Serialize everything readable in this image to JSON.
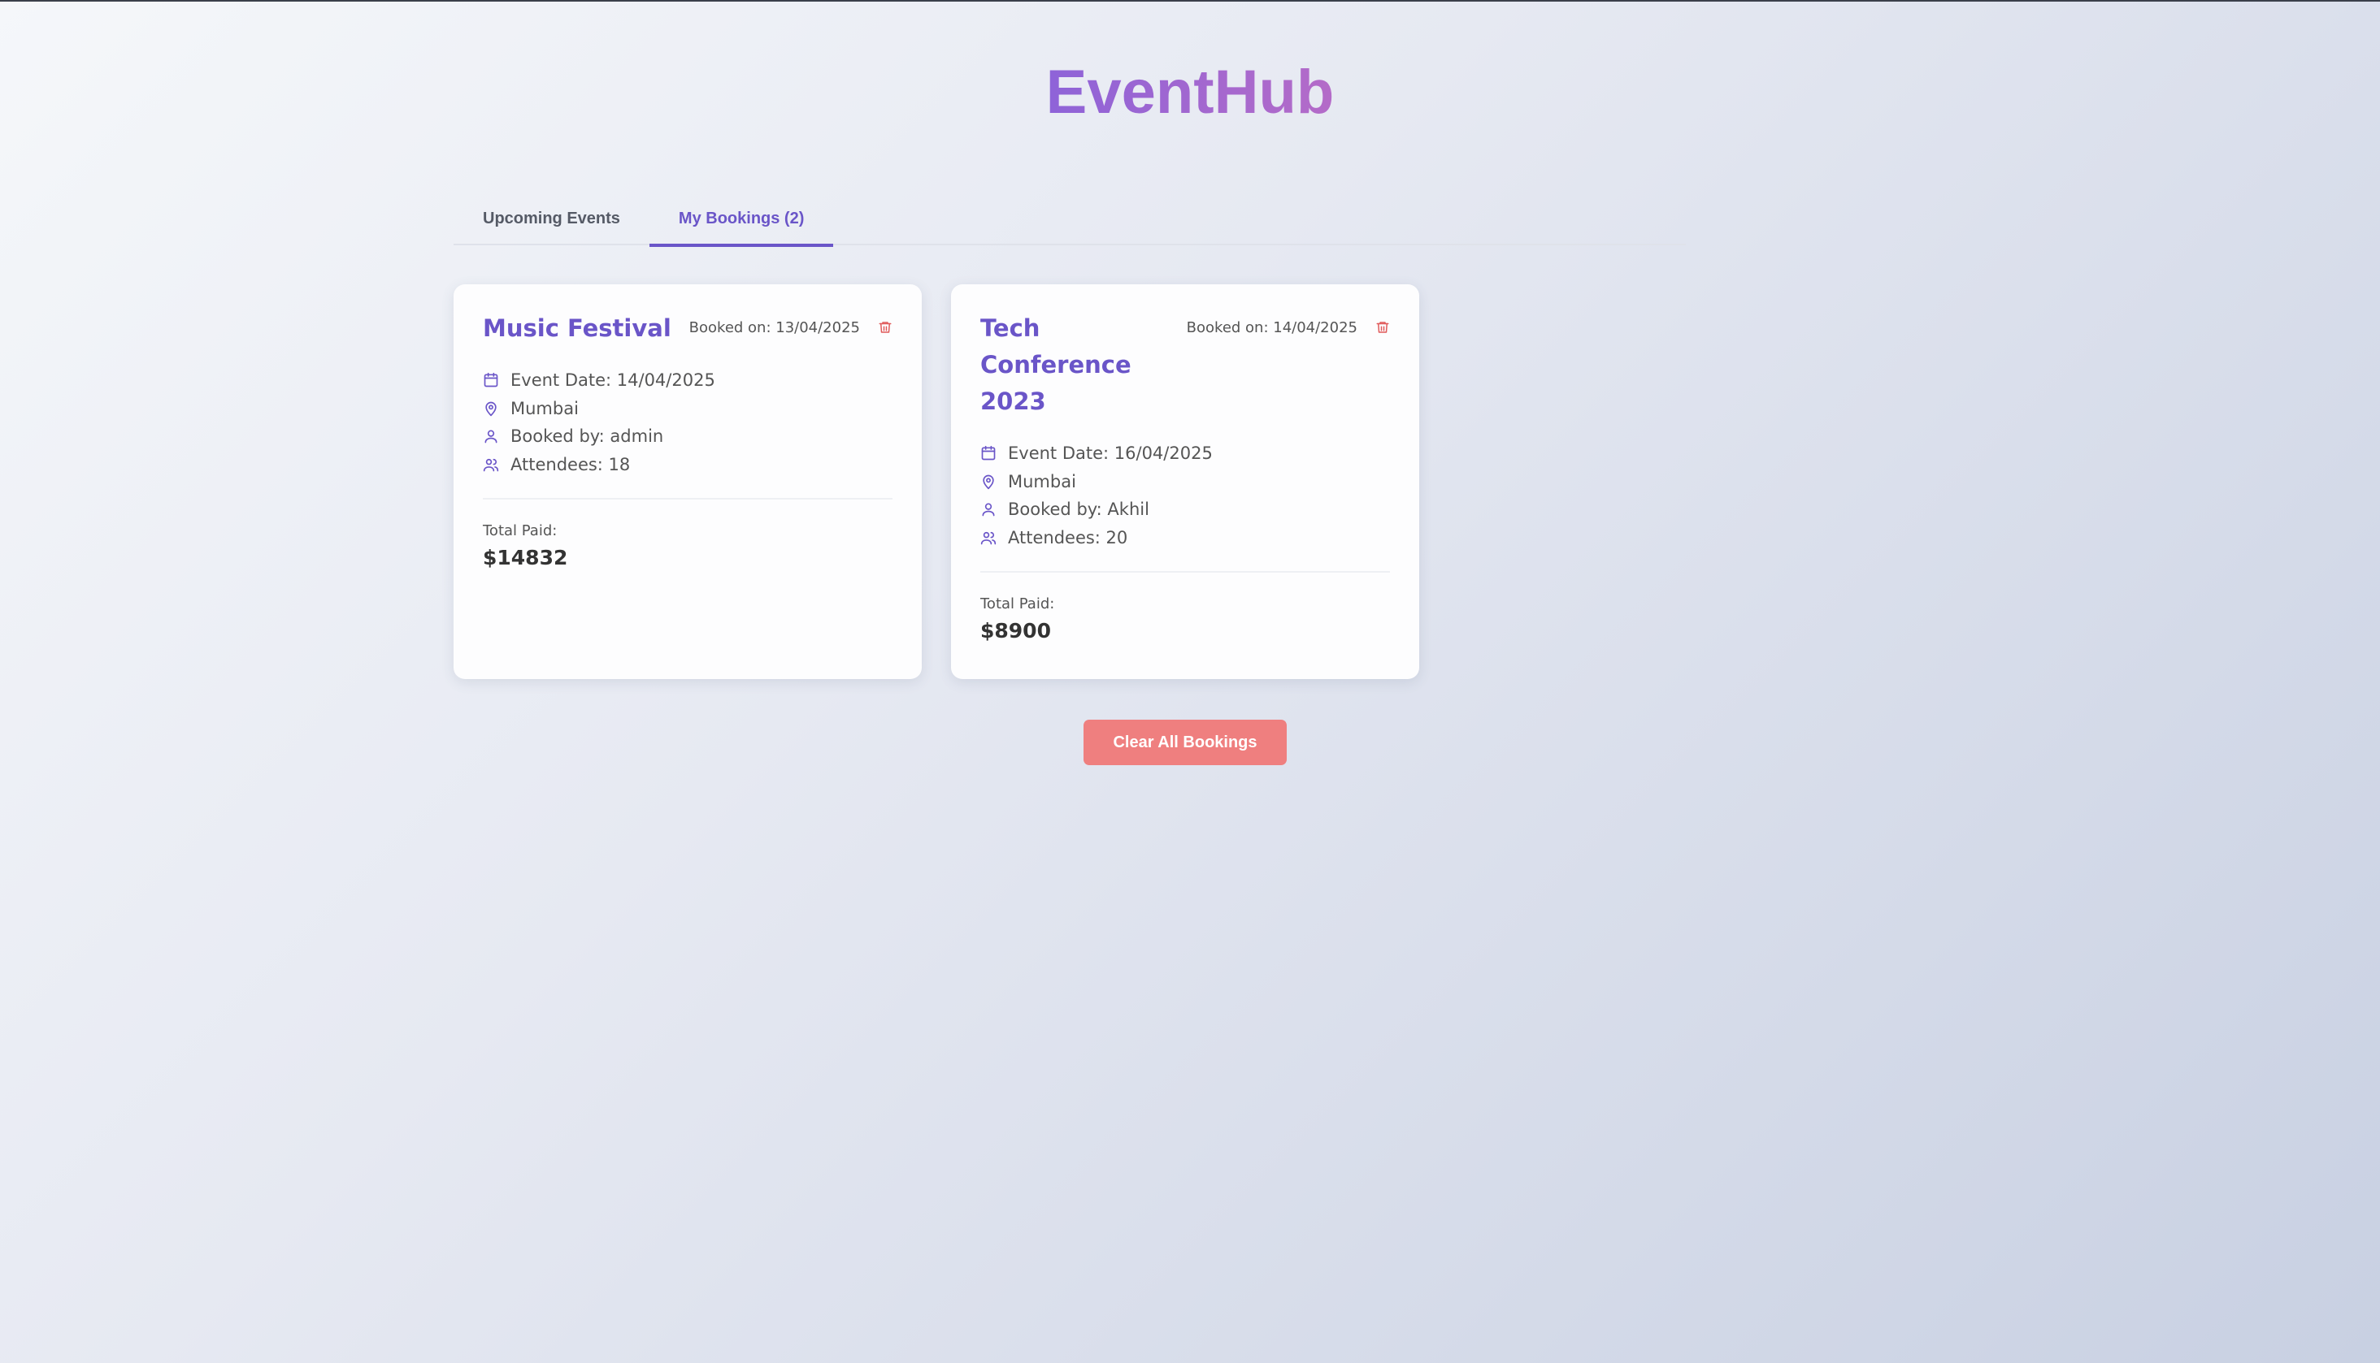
{
  "app": {
    "title": "EventHub"
  },
  "tabs": [
    {
      "label": "Upcoming Events",
      "active": false
    },
    {
      "label": "My Bookings (2)",
      "active": true
    }
  ],
  "bookings": [
    {
      "title": "Music Festival",
      "booked_on": "Booked on: 13/04/2025",
      "event_date": "Event Date: 14/04/2025",
      "location": "Mumbai",
      "booked_by": "Booked by: admin",
      "attendees": "Attendees: 18",
      "total_label": "Total Paid:",
      "total_value": "$14832"
    },
    {
      "title": "Tech Conference 2023",
      "booked_on": "Booked on: 14/04/2025",
      "event_date": "Event Date: 16/04/2025",
      "location": "Mumbai",
      "booked_by": "Booked by: Akhil",
      "attendees": "Attendees: 20",
      "total_label": "Total Paid:",
      "total_value": "$8900"
    }
  ],
  "actions": {
    "clear_all_label": "Clear All Bookings"
  },
  "colors": {
    "accent": "#6a55c8",
    "danger": "#ef7f7f",
    "trash_icon": "#e05a5a"
  },
  "icons": {
    "date": "calendar-icon",
    "location": "map-pin-icon",
    "booked_by": "user-icon",
    "attendees": "users-icon",
    "delete": "trash-icon"
  }
}
